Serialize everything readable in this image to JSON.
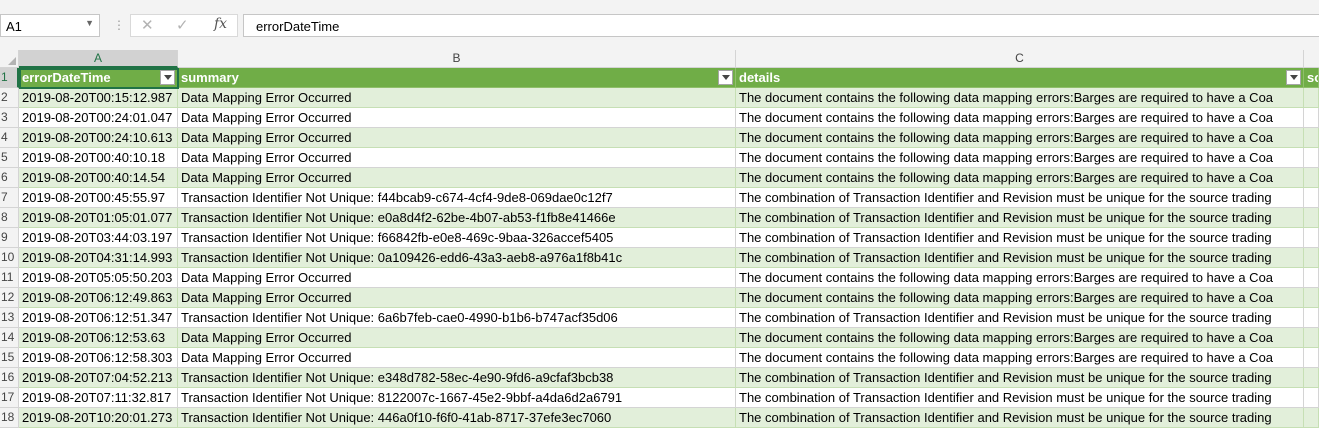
{
  "formula_bar": {
    "name_box": "A1",
    "dots_icon": "vertical-ellipsis",
    "cancel_icon": "✕",
    "enter_icon": "✓",
    "fx_label": "fx",
    "value": "errorDateTime"
  },
  "columns": [
    "A",
    "B",
    "C"
  ],
  "header_row": {
    "row_num": "1",
    "a": "errorDateTime",
    "b": "summary",
    "c": "details",
    "d": "so"
  },
  "rows": [
    {
      "n": "2",
      "a": "2019-08-20T00:15:12.987",
      "b": "Data Mapping Error Occurred",
      "c": "The document contains the following data mapping errors:Barges are required to have a Coa"
    },
    {
      "n": "3",
      "a": "2019-08-20T00:24:01.047",
      "b": "Data Mapping Error Occurred",
      "c": "The document contains the following data mapping errors:Barges are required to have a Coa"
    },
    {
      "n": "4",
      "a": "2019-08-20T00:24:10.613",
      "b": "Data Mapping Error Occurred",
      "c": "The document contains the following data mapping errors:Barges are required to have a Coa"
    },
    {
      "n": "5",
      "a": "2019-08-20T00:40:10.18",
      "b": "Data Mapping Error Occurred",
      "c": "The document contains the following data mapping errors:Barges are required to have a Coa"
    },
    {
      "n": "6",
      "a": "2019-08-20T00:40:14.54",
      "b": "Data Mapping Error Occurred",
      "c": "The document contains the following data mapping errors:Barges are required to have a Coa"
    },
    {
      "n": "7",
      "a": "2019-08-20T00:45:55.97",
      "b": "Transaction Identifier Not Unique: f44bcab9-c674-4cf4-9de8-069dae0c12f7",
      "c": "The combination of Transaction Identifier and Revision must be unique for the source trading"
    },
    {
      "n": "8",
      "a": "2019-08-20T01:05:01.077",
      "b": "Transaction Identifier Not Unique: e0a8d4f2-62be-4b07-ab53-f1fb8e41466e",
      "c": "The combination of Transaction Identifier and Revision must be unique for the source trading"
    },
    {
      "n": "9",
      "a": "2019-08-20T03:44:03.197",
      "b": "Transaction Identifier Not Unique: f66842fb-e0e8-469c-9baa-326accef5405",
      "c": "The combination of Transaction Identifier and Revision must be unique for the source trading"
    },
    {
      "n": "10",
      "a": "2019-08-20T04:31:14.993",
      "b": "Transaction Identifier Not Unique: 0a109426-edd6-43a3-aeb8-a976a1f8b41c",
      "c": "The combination of Transaction Identifier and Revision must be unique for the source trading"
    },
    {
      "n": "11",
      "a": "2019-08-20T05:05:50.203",
      "b": "Data Mapping Error Occurred",
      "c": "The document contains the following data mapping errors:Barges are required to have a Coa"
    },
    {
      "n": "12",
      "a": "2019-08-20T06:12:49.863",
      "b": "Data Mapping Error Occurred",
      "c": "The document contains the following data mapping errors:Barges are required to have a Coa"
    },
    {
      "n": "13",
      "a": "2019-08-20T06:12:51.347",
      "b": "Transaction Identifier Not Unique: 6a6b7feb-cae0-4990-b1b6-b747acf35d06",
      "c": "The combination of Transaction Identifier and Revision must be unique for the source trading"
    },
    {
      "n": "14",
      "a": "2019-08-20T06:12:53.63",
      "b": "Data Mapping Error Occurred",
      "c": "The document contains the following data mapping errors:Barges are required to have a Coa"
    },
    {
      "n": "15",
      "a": "2019-08-20T06:12:58.303",
      "b": "Data Mapping Error Occurred",
      "c": "The document contains the following data mapping errors:Barges are required to have a Coa"
    },
    {
      "n": "16",
      "a": "2019-08-20T07:04:52.213",
      "b": "Transaction Identifier Not Unique: e348d782-58ec-4e90-9fd6-a9cfaf3bcb38",
      "c": "The combination of Transaction Identifier and Revision must be unique for the source trading"
    },
    {
      "n": "17",
      "a": "2019-08-20T07:11:32.817",
      "b": "Transaction Identifier Not Unique: 8122007c-1667-45e2-9bbf-a4da6d2a6791",
      "c": "The combination of Transaction Identifier and Revision must be unique for the source trading"
    },
    {
      "n": "18",
      "a": "2019-08-20T10:20:01.273",
      "b": "Transaction Identifier Not Unique: 446a0f10-f6f0-41ab-8717-37efe3ec7060",
      "c": "The combination of Transaction Identifier and Revision must be unique for the source trading"
    }
  ],
  "colors": {
    "header_fill": "#70ad47",
    "band_fill": "#e2efda",
    "selection": "#217346"
  }
}
